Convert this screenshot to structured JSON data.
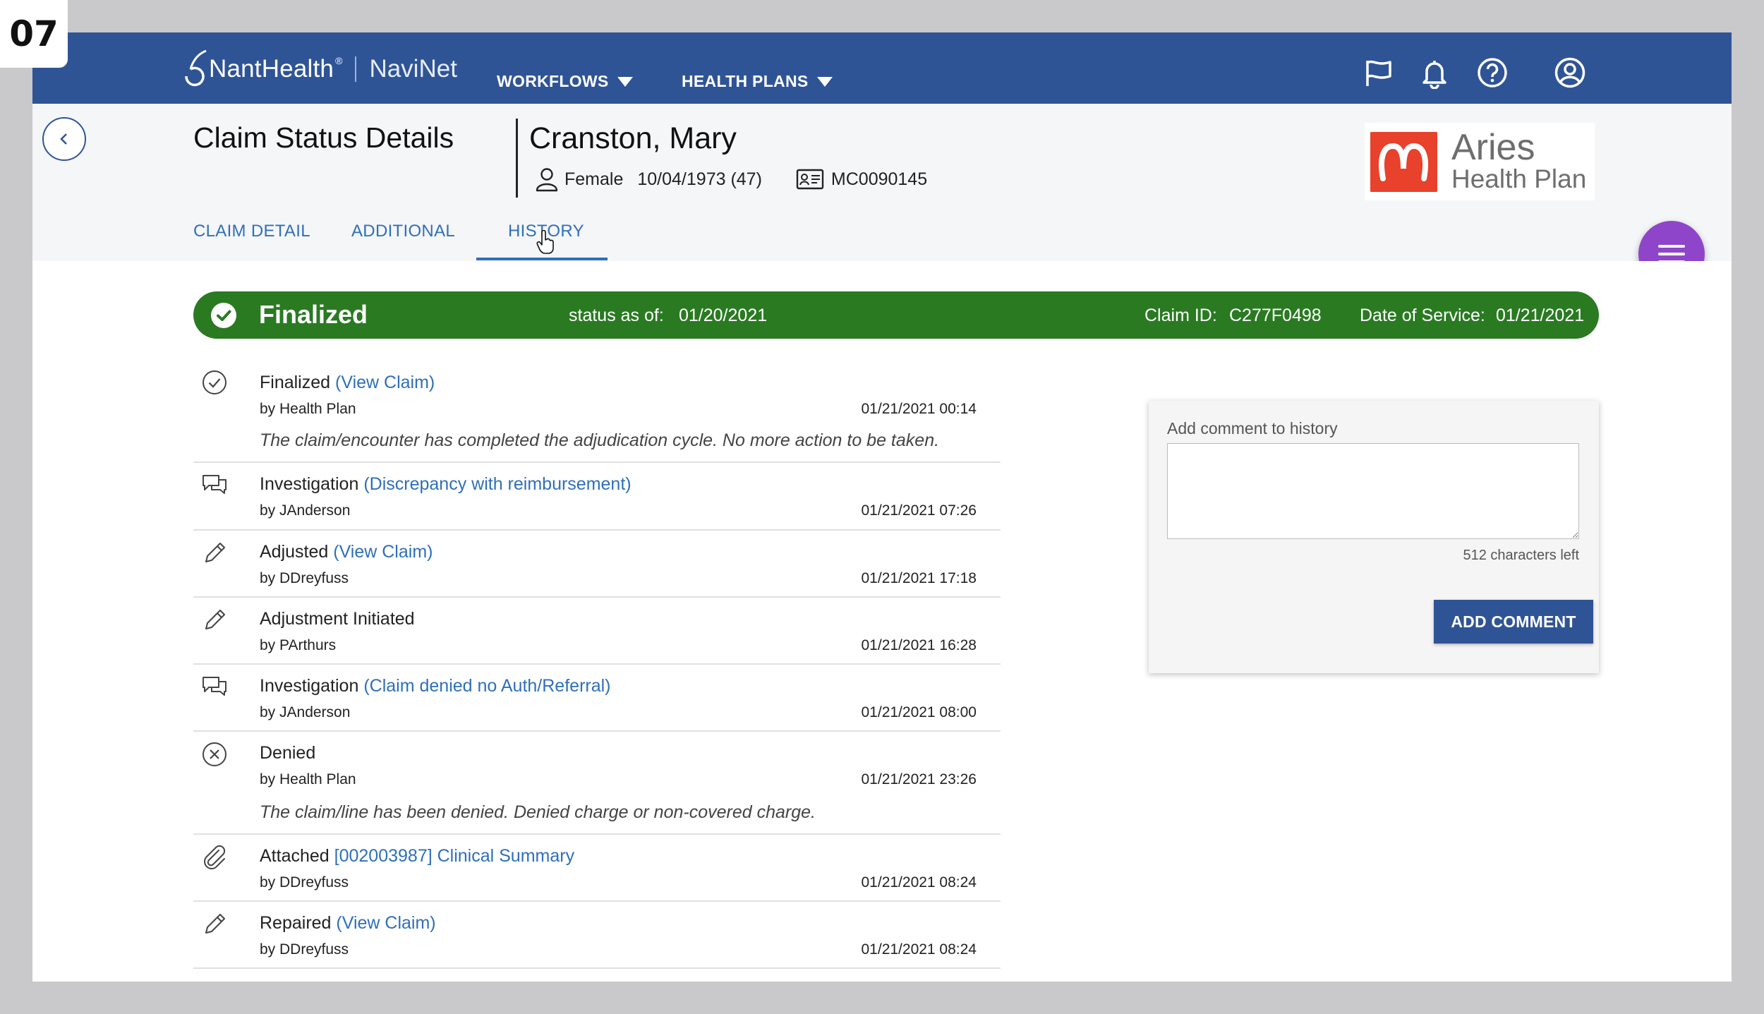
{
  "step_badge": "07",
  "nav": {
    "brand_primary": "NantHealth",
    "brand_secondary": "NaviNet",
    "menus": [
      "WORKFLOWS",
      "HEALTH PLANS"
    ],
    "icons": [
      "flag-icon",
      "bell-icon",
      "help-icon",
      "user-account-icon"
    ]
  },
  "header": {
    "page_title": "Claim Status Details",
    "patient_name": "Cranston, Mary",
    "gender": "Female",
    "dob": "10/04/1973 (47)",
    "member_id": "MC0090145",
    "plan_logo": {
      "line1": "Aries",
      "line2": "Health Plan",
      "color": "#e8412c"
    }
  },
  "tabs": [
    {
      "label": "CLAIM DETAIL",
      "active": false
    },
    {
      "label": "ADDITIONAL",
      "active": false
    },
    {
      "label": "HISTORY",
      "active": true
    }
  ],
  "status": {
    "state": "Finalized",
    "status_as_of_label": "status as of:",
    "status_as_of": "01/20/2021",
    "claim_id_label": "Claim ID:",
    "claim_id": "C277F0498",
    "dos_label": "Date of Service:",
    "dos": "01/21/2021",
    "color": "#2a7a22"
  },
  "history": [
    {
      "icon": "check-circle-icon",
      "action": "Finalized",
      "link": "(View Claim)",
      "by": "by Health Plan",
      "time": "01/21/2021 00:14",
      "note": "The claim/encounter has completed the adjudication cycle. No more action to be taken."
    },
    {
      "icon": "chat-bubbles-icon",
      "action": "Investigation",
      "link": "(Discrepancy with reimbursement)",
      "by": "by JAnderson",
      "time": "01/21/2021 07:26",
      "note": ""
    },
    {
      "icon": "pencil-icon",
      "action": "Adjusted",
      "link": "(View Claim)",
      "by": "by DDreyfuss",
      "time": "01/21/2021 17:18",
      "note": ""
    },
    {
      "icon": "pencil-icon",
      "action": "Adjustment Initiated",
      "link": "",
      "by": "by PArthurs",
      "time": "01/21/2021 16:28",
      "note": ""
    },
    {
      "icon": "chat-bubbles-icon",
      "action": "Investigation",
      "link": "(Claim denied no Auth/Referral)",
      "by": "by JAnderson",
      "time": "01/21/2021 08:00",
      "note": ""
    },
    {
      "icon": "x-circle-icon",
      "action": "Denied",
      "link": "",
      "by": "by Health Plan",
      "time": "01/21/2021 23:26",
      "note": "The claim/line has been denied. Denied charge or non-covered charge."
    },
    {
      "icon": "paperclip-icon",
      "action": "Attached",
      "link": "[002003987] Clinical Summary",
      "by": "by DDreyfuss",
      "time": "01/21/2021 08:24",
      "note": ""
    },
    {
      "icon": "pencil-icon",
      "action": "Repaired",
      "link": "(View Claim)",
      "by": "by DDreyfuss",
      "time": "01/21/2021 08:24",
      "note": ""
    }
  ],
  "comment": {
    "label": "Add comment to history",
    "value": "",
    "chars_left": "512 characters left",
    "button": "ADD COMMENT"
  }
}
